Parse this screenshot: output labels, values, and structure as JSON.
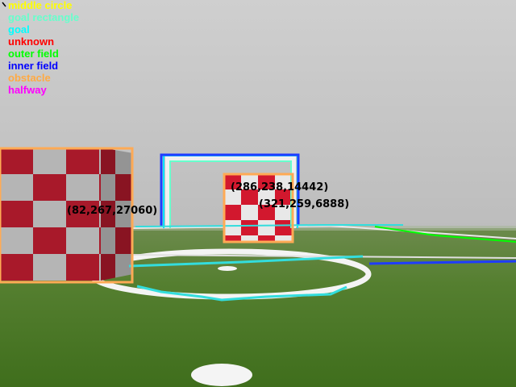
{
  "legend": [
    {
      "label": "middle circle",
      "color": "#ffff00"
    },
    {
      "label": "goal rectangle",
      "color": "#66ffcc"
    },
    {
      "label": "goal",
      "color": "#00ffff"
    },
    {
      "label": "unknown",
      "color": "#ff0000"
    },
    {
      "label": "outer field",
      "color": "#00ff00"
    },
    {
      "label": "inner field",
      "color": "#0000ff"
    },
    {
      "label": "obstacle",
      "color": "#ffaa44"
    },
    {
      "label": "halfway",
      "color": "#ff00ff"
    }
  ],
  "detections": [
    {
      "label": "(82,267,27060)"
    },
    {
      "label": "(286,238,14442)"
    },
    {
      "label": "(321,259,6888)"
    }
  ],
  "colors": {
    "sky": "#c8c8c8",
    "field": "#4f7f2c",
    "obstacle_red": "#a8192a",
    "obstacle_light": "#cfcfcf"
  }
}
